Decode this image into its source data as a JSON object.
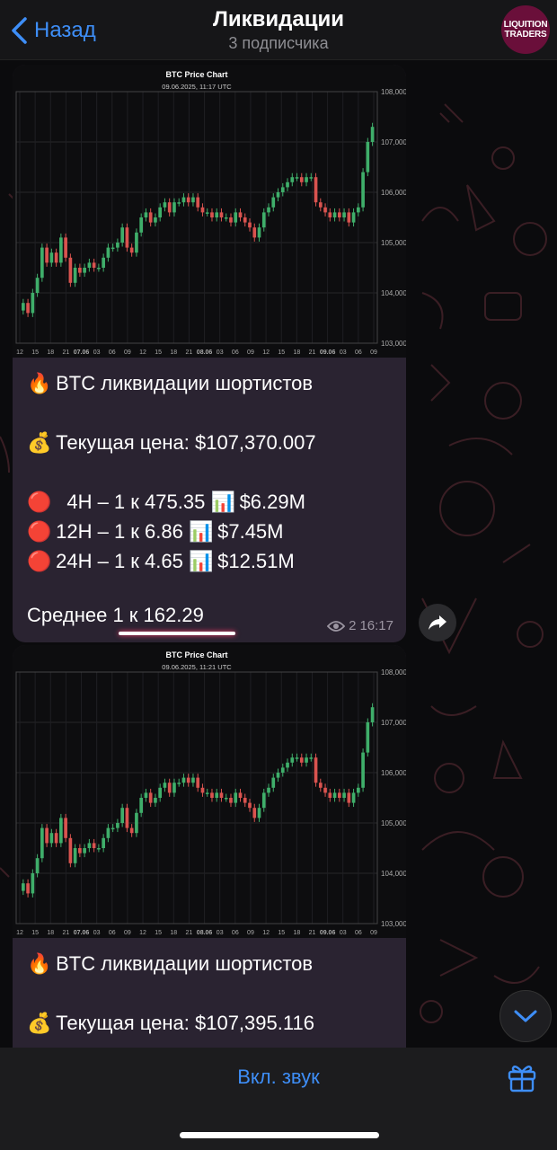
{
  "header": {
    "back_label": "Назад",
    "title": "Ликвидации",
    "subtitle": "3 подписчика",
    "avatar_line1": "LIQUITION",
    "avatar_line2": "TRADERS"
  },
  "messages": [
    {
      "chart": {
        "title": "BTC Price Chart",
        "timestamp": "09.06.2025, 11:17 UTC",
        "y_ticks": [
          "108,000",
          "107,000",
          "106,000",
          "105,000",
          "104,000",
          "103,000"
        ],
        "x_ticks": [
          "12",
          "15",
          "18",
          "21",
          "07.06",
          "03",
          "06",
          "09",
          "12",
          "15",
          "18",
          "21",
          "08.06",
          "03",
          "06",
          "09",
          "12",
          "15",
          "18",
          "21",
          "09.06",
          "03",
          "06",
          "09"
        ]
      },
      "line1": "BTC ликвидации шортистов",
      "line2": "Текущая цена: $107,370.007",
      "line3": "  4H – 1 к 475.35",
      "line3_val": "$6.29M",
      "line4": "12H – 1 к 6.86",
      "line4_val": "$7.45M",
      "line5": "24H – 1 к 4.65",
      "line5_val": "$12.51M",
      "avg": "Среднее 1 к 162.29",
      "views": "2",
      "time": "16:17"
    },
    {
      "chart": {
        "title": "BTC Price Chart",
        "timestamp": "09.06.2025, 11:21 UTC",
        "y_ticks": [
          "108,000",
          "107,000",
          "106,000",
          "105,000",
          "104,000",
          "103,000"
        ],
        "x_ticks": [
          "12",
          "15",
          "18",
          "21",
          "07.06",
          "03",
          "06",
          "09",
          "12",
          "15",
          "18",
          "21",
          "08.06",
          "03",
          "06",
          "09",
          "12",
          "15",
          "18",
          "21",
          "09.06",
          "03",
          "06",
          "09"
        ]
      },
      "line1": "BTC ликвидации шортистов",
      "line2": "Текущая цена: $107,395.116"
    }
  ],
  "candles": [
    103.8,
    103.6,
    104.0,
    104.3,
    104.9,
    104.6,
    104.8,
    104.6,
    105.1,
    104.7,
    104.2,
    104.5,
    104.4,
    104.5,
    104.6,
    104.5,
    104.5,
    104.7,
    104.9,
    104.9,
    105.0,
    105.3,
    104.9,
    104.8,
    105.2,
    105.5,
    105.6,
    105.4,
    105.5,
    105.7,
    105.8,
    105.6,
    105.8,
    105.8,
    105.9,
    105.8,
    105.9,
    105.7,
    105.6,
    105.6,
    105.5,
    105.6,
    105.5,
    105.5,
    105.4,
    105.6,
    105.5,
    105.4,
    105.3,
    105.1,
    105.3,
    105.6,
    105.7,
    105.9,
    106.0,
    106.1,
    106.2,
    106.3,
    106.3,
    106.2,
    106.3,
    106.3,
    105.8,
    105.7,
    105.6,
    105.5,
    105.6,
    105.5,
    105.6,
    105.4,
    105.6,
    105.7,
    106.4,
    107.0,
    107.3
  ],
  "colors": {
    "accent": "#3e8ef7",
    "up": "#3fae6a",
    "down": "#d9534f",
    "bubble": "#2a2331"
  },
  "bottom": {
    "unmute_label": "Вкл. звук"
  }
}
